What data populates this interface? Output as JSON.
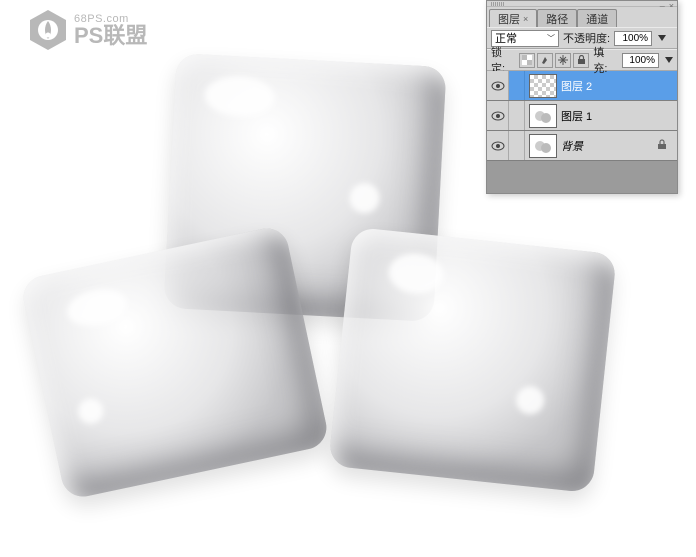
{
  "watermark": {
    "url": "68PS.com",
    "brand": "PS联盟"
  },
  "panel": {
    "tabs": {
      "layers": "图层",
      "paths": "路径",
      "channels": "通道"
    },
    "blend_mode_label": "正常",
    "opacity_label": "不透明度:",
    "opacity_value": "100%",
    "lock_label": "锁定:",
    "fill_label": "填充:",
    "fill_value": "100%",
    "layers": [
      {
        "name": "图层 2",
        "selected": true,
        "locked": false,
        "thumb": "checker"
      },
      {
        "name": "图层 1",
        "selected": false,
        "locked": false,
        "thumb": "ice"
      },
      {
        "name": "背景",
        "selected": false,
        "locked": true,
        "thumb": "ice"
      }
    ]
  }
}
